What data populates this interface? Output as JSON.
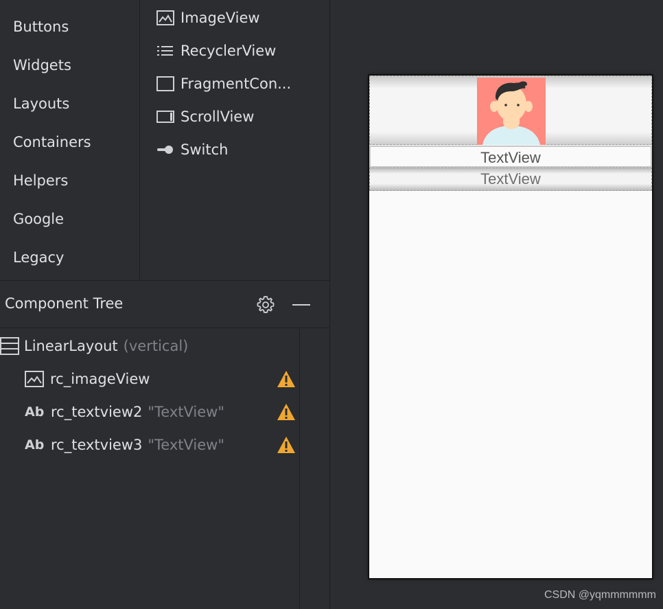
{
  "palette": {
    "categories": [
      "Buttons",
      "Widgets",
      "Layouts",
      "Containers",
      "Helpers",
      "Google",
      "Legacy"
    ],
    "items": [
      {
        "label": "ImageView",
        "icon": "image-icon"
      },
      {
        "label": "RecyclerView",
        "icon": "list-icon"
      },
      {
        "label": "FragmentCon...",
        "icon": "fragment-container-icon"
      },
      {
        "label": "ScrollView",
        "icon": "scrollview-icon"
      },
      {
        "label": "Switch",
        "icon": "switch-icon"
      }
    ]
  },
  "component_tree": {
    "title": "Component Tree",
    "root": {
      "name": "LinearLayout",
      "hint": "(vertical)",
      "icon": "linear-layout-icon"
    },
    "children": [
      {
        "name": "rc_imageView",
        "hint": "",
        "icon": "image-icon",
        "warning": true
      },
      {
        "name": "rc_textview2",
        "hint": "\"TextView\"",
        "icon": "text-ab-icon",
        "icon_text": "Ab",
        "warning": true
      },
      {
        "name": "rc_textview3",
        "hint": "\"TextView\"",
        "icon": "text-ab-icon",
        "icon_text": "Ab",
        "warning": true
      }
    ]
  },
  "design": {
    "textview2": "TextView",
    "textview3": "TextView",
    "avatar_bg": "#ff8a80"
  },
  "watermark": "CSDN @yqmmmmmm"
}
